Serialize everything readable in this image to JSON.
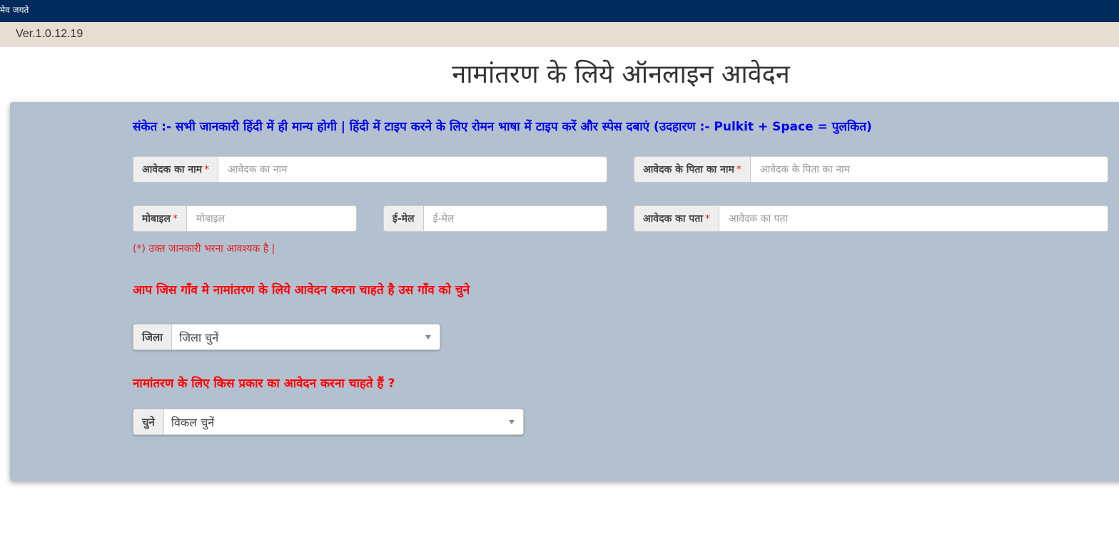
{
  "header": {
    "motto": "मेव जयते",
    "version": "Ver.1.0.12.19"
  },
  "page_title": "नामांतरण के लिये ऑनलाइन आवेदन",
  "hint": "संकेत :- सभी जानकारी हिंदी में ही मान्य होगी | हिंदी में टाइप करने के लिए रोमन भाषा में टाइप करें और स्पेस दबाएं (उदहारण :- Pulkit + Space = पुलकित)",
  "form": {
    "applicant_name": {
      "label": "आवेदक का नाम",
      "required_mark": "*",
      "placeholder": "आवेदक का नाम",
      "value": ""
    },
    "father_name": {
      "label": "आवेदक के पिता का नाम",
      "required_mark": "*",
      "placeholder": "आवेदक के पिता का नाम",
      "value": ""
    },
    "mobile": {
      "label": "मोबाइल",
      "required_mark": "*",
      "placeholder": "मोबाइल",
      "value": ""
    },
    "email": {
      "label": "ई-मेल",
      "placeholder": "ई-मेल",
      "value": ""
    },
    "address": {
      "label": "आवेदक का पता",
      "required_mark": "*",
      "placeholder": "आवेदक का पता",
      "value": ""
    },
    "required_note": "(*) उक्त जानकारी भरना आवश्यक है |"
  },
  "village_section": {
    "question": "आप जिस गाँव मे नामांतरण के लिये आवेदन करना चाहते है उस गाँव को चुने",
    "district": {
      "label": "जिला",
      "selected": "जिला चुनें"
    }
  },
  "type_section": {
    "question": "नामांतरण के लिए किस प्रकार का आवेदन करना चाहते हैं ?",
    "option": {
      "label": "चुने",
      "selected": "विकल चुनें"
    }
  },
  "colors": {
    "topbar": "#002b5c",
    "version_bar": "#e8ddd1",
    "panel": "#b3c0cf",
    "hint": "#0000ee",
    "question": "#ff0000",
    "required": "#e02020"
  }
}
